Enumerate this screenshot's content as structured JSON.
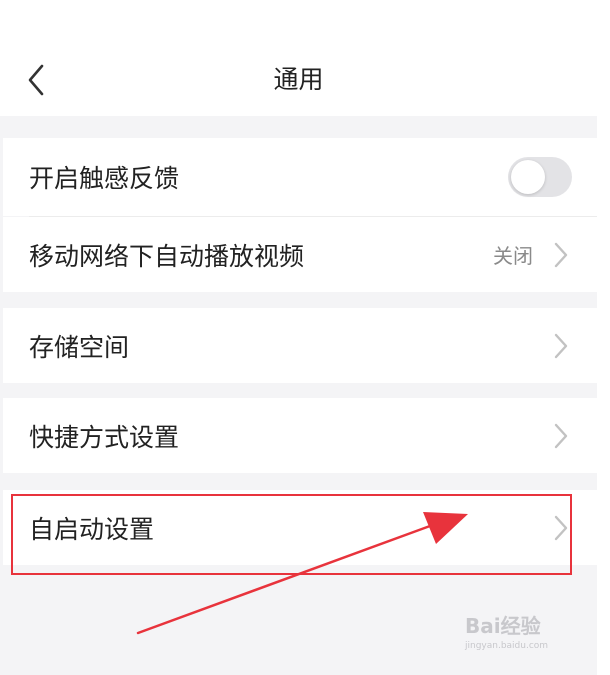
{
  "header": {
    "title": "通用",
    "back_icon": "chevron-left-icon"
  },
  "settings": {
    "haptic": {
      "label": "开启触感反馈",
      "enabled": false
    },
    "autoplay": {
      "label": "移动网络下自动播放视频",
      "value": "关闭"
    },
    "storage": {
      "label": "存储空间"
    },
    "shortcut": {
      "label": "快捷方式设置"
    },
    "autostart": {
      "label": "自启动设置"
    }
  },
  "annotation": {
    "highlight_color": "#e8333c"
  },
  "watermark": {
    "brand": "Bai经验",
    "url": "jingyan.baidu.com"
  },
  "colors": {
    "background": "#f4f4f6",
    "card": "#ffffff",
    "secondary_text": "#8a8a8a",
    "chevron": "#c2c2c2"
  }
}
